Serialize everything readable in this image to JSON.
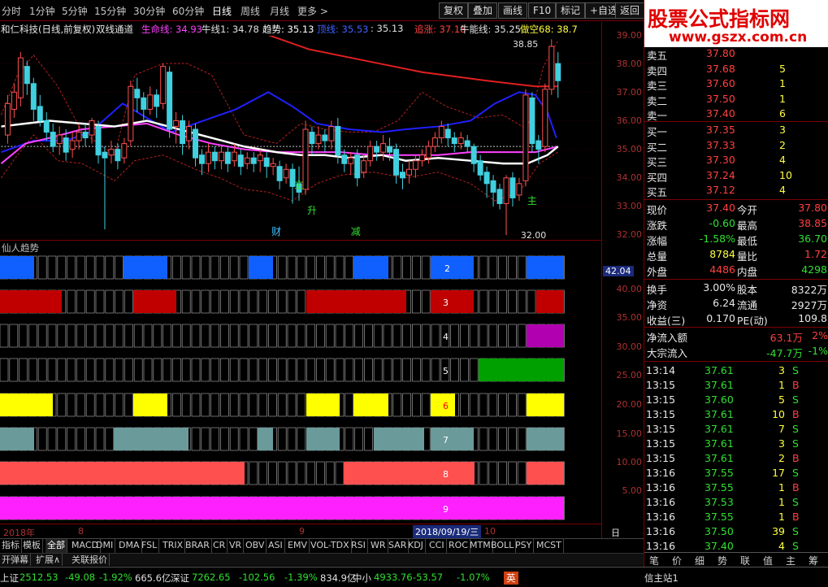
{
  "top": {
    "periods": [
      "分时",
      "1分钟",
      "5分钟",
      "15分钟",
      "30分钟",
      "60分钟",
      "日线",
      "周线",
      "月线",
      "更多 >"
    ],
    "active_period": "日线",
    "tools": [
      "复权",
      "叠加",
      "画线",
      "F10",
      "标记",
      "+自选",
      "返回"
    ]
  },
  "info": {
    "stock": "和仁科技(日线,前复权)",
    "indicator": "双线通道",
    "items": [
      {
        "text": "生命线: 34.93",
        "color": "#ff40ff"
      },
      {
        "text": "牛线1: 34.78",
        "color": "#e0e0e0"
      },
      {
        "text": "趋势: 35.13",
        "color": "#ffffff"
      },
      {
        "text": "顶线: 35.53",
        "color": "#4060ff"
      },
      {
        "text": ": 35.13",
        "color": "#e0e0e0"
      },
      {
        "text": "追涨: 37.18",
        "color": "#ff4040"
      },
      {
        "text": "牛能线: 35.25",
        "color": "#e0e0e0"
      },
      {
        "text": "做空68: 38.7",
        "color": "#ffff40"
      }
    ]
  },
  "main_chart": {
    "y_axis": [
      "39.00",
      "38.00",
      "37.00",
      "36.00",
      "35.00",
      "34.00",
      "33.00",
      "32.00"
    ],
    "high_label": "38.85",
    "low_label": "32.00",
    "markers": [
      {
        "text": "主",
        "color": "#30e030"
      },
      {
        "text": "升",
        "color": "#30e030"
      },
      {
        "text": "财",
        "color": "#40c0ff"
      },
      {
        "text": "减",
        "color": "#30e030"
      },
      {
        "text": "主",
        "color": "#30e030"
      }
    ]
  },
  "lower_chart": {
    "title": "仙人趋势",
    "value_label": "42.04",
    "y_axis": [
      "40.00",
      "35.00",
      "30.00",
      "25.00",
      "20.00",
      "15.00",
      "10.00",
      "5.00"
    ],
    "row_labels": [
      "2",
      "3",
      "4",
      "5",
      "6",
      "7",
      "8",
      "9"
    ]
  },
  "dates": {
    "year": "2018年",
    "m8": "8",
    "m9": "9",
    "cursor": "2018/09/19/三",
    "m10": "10",
    "period": "日线"
  },
  "tabs": [
    "指标",
    "模板",
    "全部",
    "MACD",
    "DMI",
    "DMA",
    "FSL",
    "TRIX",
    "BRAR",
    "CR",
    "VR",
    "OBV",
    "ASI",
    "EMV",
    "VOL-TDX",
    "RSI",
    "WR",
    "SAR",
    "KDJ",
    "CCI",
    "ROC",
    "MTM",
    "BOLL",
    "PSY",
    "MCST"
  ],
  "subtabs": [
    "开弹幕",
    "扩展∧",
    "关联报价"
  ],
  "status": [
    {
      "text": "上证",
      "color": "#e0e0e0"
    },
    {
      "text": "2512.53",
      "color": "#30e030"
    },
    {
      "text": "-49.08",
      "color": "#30e030"
    },
    {
      "text": "-1.92%",
      "color": "#30e030"
    },
    {
      "text": "665.6亿",
      "color": "#e0e0e0"
    },
    {
      "text": "深证",
      "color": "#e0e0e0"
    },
    {
      "text": "7262.65",
      "color": "#30e030"
    },
    {
      "text": "-102.56",
      "color": "#30e030"
    },
    {
      "text": "-1.39%",
      "color": "#30e030"
    },
    {
      "text": "834.9亿",
      "color": "#e0e0e0"
    },
    {
      "text": "中小",
      "color": "#e0e0e0"
    },
    {
      "text": "4933.76",
      "color": "#30e030"
    },
    {
      "text": "-53.57",
      "color": "#30e030"
    },
    {
      "text": "-1.07%",
      "color": "#30e030"
    }
  ],
  "ime": {
    "label": "英",
    "site": "信主站1"
  },
  "watermark": {
    "title": "股票公式指标网",
    "url": "www.gszx.com.cn"
  },
  "orderbook": {
    "asks": [
      {
        "label": "卖五",
        "price": "37.80",
        "vol": ""
      },
      {
        "label": "卖四",
        "price": "37.68",
        "vol": "5"
      },
      {
        "label": "卖三",
        "price": "37.60",
        "vol": "1"
      },
      {
        "label": "卖二",
        "price": "37.50",
        "vol": "1"
      },
      {
        "label": "卖一",
        "price": "37.40",
        "vol": "6"
      }
    ],
    "bids": [
      {
        "label": "买一",
        "price": "37.35",
        "vol": "3"
      },
      {
        "label": "买二",
        "price": "37.33",
        "vol": "2"
      },
      {
        "label": "买三",
        "price": "37.30",
        "vol": "4"
      },
      {
        "label": "买四",
        "price": "37.24",
        "vol": "10"
      },
      {
        "label": "买五",
        "price": "37.12",
        "vol": "4"
      }
    ]
  },
  "quote": [
    {
      "l1": "现价",
      "v1": "37.40",
      "c1": "#ff4040",
      "l2": "今开",
      "v2": "37.80",
      "c2": "#ff4040"
    },
    {
      "l1": "涨跌",
      "v1": "-0.60",
      "c1": "#30e030",
      "l2": "最高",
      "v2": "38.85",
      "c2": "#ff4040"
    },
    {
      "l1": "涨幅",
      "v1": "-1.58%",
      "c1": "#30e030",
      "l2": "最低",
      "v2": "36.70",
      "c2": "#30e030"
    },
    {
      "l1": "总量",
      "v1": "8784",
      "c1": "#ffff40",
      "l2": "量比",
      "v2": "1.72",
      "c2": "#ff4040"
    },
    {
      "l1": "外盘",
      "v1": "4486",
      "c1": "#ff4040",
      "l2": "内盘",
      "v2": "4298",
      "c2": "#30e030"
    }
  ],
  "quote2": [
    {
      "l1": "换手",
      "v1": "3.00%",
      "c1": "#e8e8e8",
      "l2": "股本",
      "v2": "8322万",
      "c2": "#e8e8e8"
    },
    {
      "l1": "净资",
      "v1": "6.24",
      "c1": "#e8e8e8",
      "l2": "流通",
      "v2": "2927万",
      "c2": "#e8e8e8"
    },
    {
      "l1": "收益(三)",
      "v1": "0.170",
      "c1": "#e8e8e8",
      "l2": "PE(动)",
      "v2": "109.8",
      "c2": "#e8e8e8"
    }
  ],
  "flow": [
    {
      "label": "净流入额",
      "value": "63.1万",
      "pct": "2%",
      "color": "#ff4040"
    },
    {
      "label": "大宗流入",
      "value": "-47.7万",
      "pct": "-1%",
      "color": "#30e030"
    }
  ],
  "ticks": [
    {
      "t": "13:14",
      "p": "37.61",
      "v": "3",
      "bs": "S"
    },
    {
      "t": "13:15",
      "p": "37.61",
      "v": "1",
      "bs": "B"
    },
    {
      "t": "13:15",
      "p": "37.60",
      "v": "5",
      "bs": "S"
    },
    {
      "t": "13:15",
      "p": "37.61",
      "v": "10",
      "bs": "B"
    },
    {
      "t": "13:15",
      "p": "37.61",
      "v": "7",
      "bs": "S"
    },
    {
      "t": "13:15",
      "p": "37.61",
      "v": "3",
      "bs": "S"
    },
    {
      "t": "13:15",
      "p": "37.61",
      "v": "2",
      "bs": "B"
    },
    {
      "t": "13:16",
      "p": "37.55",
      "v": "17",
      "bs": "S"
    },
    {
      "t": "13:16",
      "p": "37.55",
      "v": "1",
      "bs": "B"
    },
    {
      "t": "13:16",
      "p": "37.53",
      "v": "1",
      "bs": "S"
    },
    {
      "t": "13:16",
      "p": "37.55",
      "v": "1",
      "bs": "B"
    },
    {
      "t": "13:16",
      "p": "37.50",
      "v": "39",
      "bs": "S"
    },
    {
      "t": "13:16",
      "p": "37.40",
      "v": "4",
      "bs": "S"
    }
  ],
  "bottom_tabs": [
    "笔",
    "价",
    "细",
    "势",
    "联",
    "值",
    "主",
    "筹"
  ]
}
